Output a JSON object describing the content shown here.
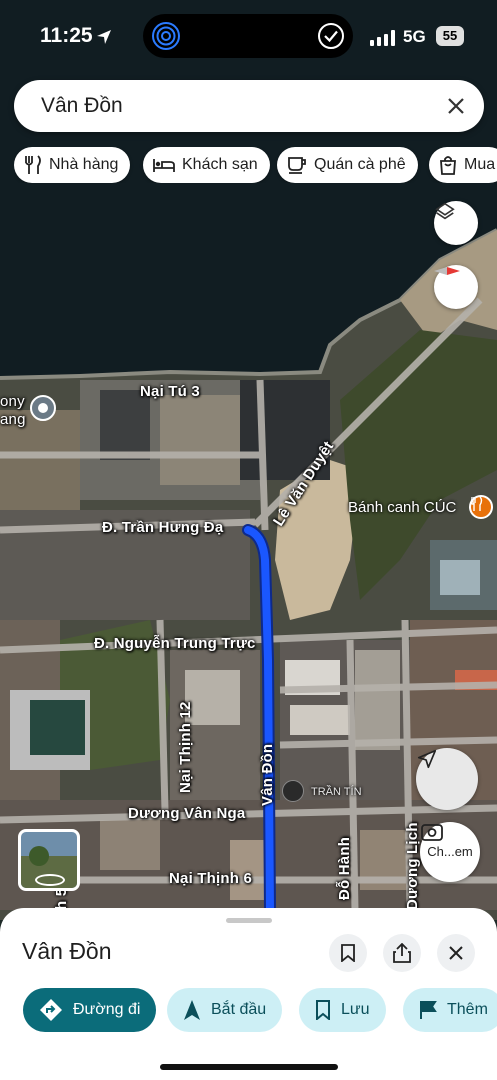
{
  "status_bar": {
    "time": "11:25",
    "network": "5G",
    "battery": "55"
  },
  "search": {
    "query": "Vân Đồn"
  },
  "chips": [
    {
      "label": "Nhà hàng",
      "icon": "fork-knife-icon"
    },
    {
      "label": "Khách sạn",
      "icon": "bed-icon"
    },
    {
      "label": "Quán cà phê",
      "icon": "coffee-cup-icon"
    },
    {
      "label": "Mua",
      "icon": "shopping-bag-icon"
    }
  ],
  "map": {
    "roads": {
      "nai_tu_3": "Nại Tú 3",
      "le_van_duyet": "Lê Văn Duyệt",
      "tran_hung_dao": "Đ. Trần Hưng Đạ",
      "nguyen_trung_truc": "Đ. Nguyễn Trung Trực",
      "nai_thinh_12": "Nại Thịnh 12",
      "van_don": "Vân Đồn",
      "duong_van_nga": "Dương Vân Nga",
      "nai_thinh_6": "Nại Thịnh 6",
      "do_hanh": "Đỗ Hành",
      "duong_lich": "Dương Lịch",
      "left_edge_1": "ony",
      "left_edge_2": "ang",
      "left_edge_3": "h 5"
    },
    "pois": {
      "banh_canh": "Bánh canh CÚC",
      "tran_tin": "TRẦN TÍN"
    },
    "route_color": "#1a57ff",
    "camera_label": "Ch...em"
  },
  "sheet": {
    "title": "Vân Đồn",
    "actions": [
      {
        "label": "Đường đi",
        "icon": "directions-icon"
      },
      {
        "label": "Bắt đầu",
        "icon": "navigation-arrow-icon"
      },
      {
        "label": "Lưu",
        "icon": "bookmark-icon"
      },
      {
        "label": "Thêm",
        "icon": "flag-icon"
      }
    ]
  }
}
